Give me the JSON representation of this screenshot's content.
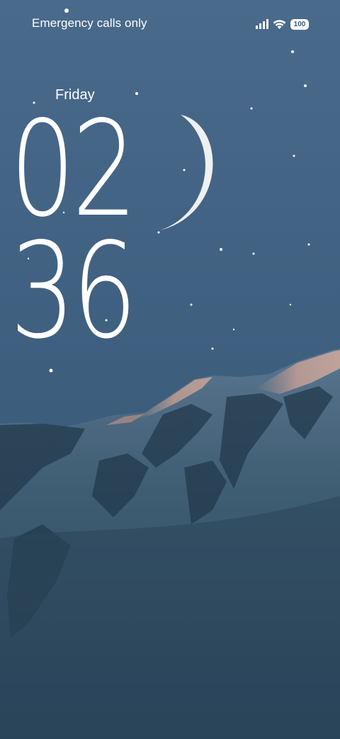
{
  "status_bar": {
    "carrier_text": "Emergency calls only",
    "battery_level": "100",
    "icons": [
      "signal-icon",
      "wifi-icon",
      "battery-icon"
    ]
  },
  "lock_screen": {
    "weekday": "Friday",
    "clock_hours": "02",
    "clock_minutes": "36"
  },
  "wallpaper": {
    "description_icon": "moon-icon",
    "sky_color": "#46668a",
    "snow_color": "#2f4d63"
  }
}
